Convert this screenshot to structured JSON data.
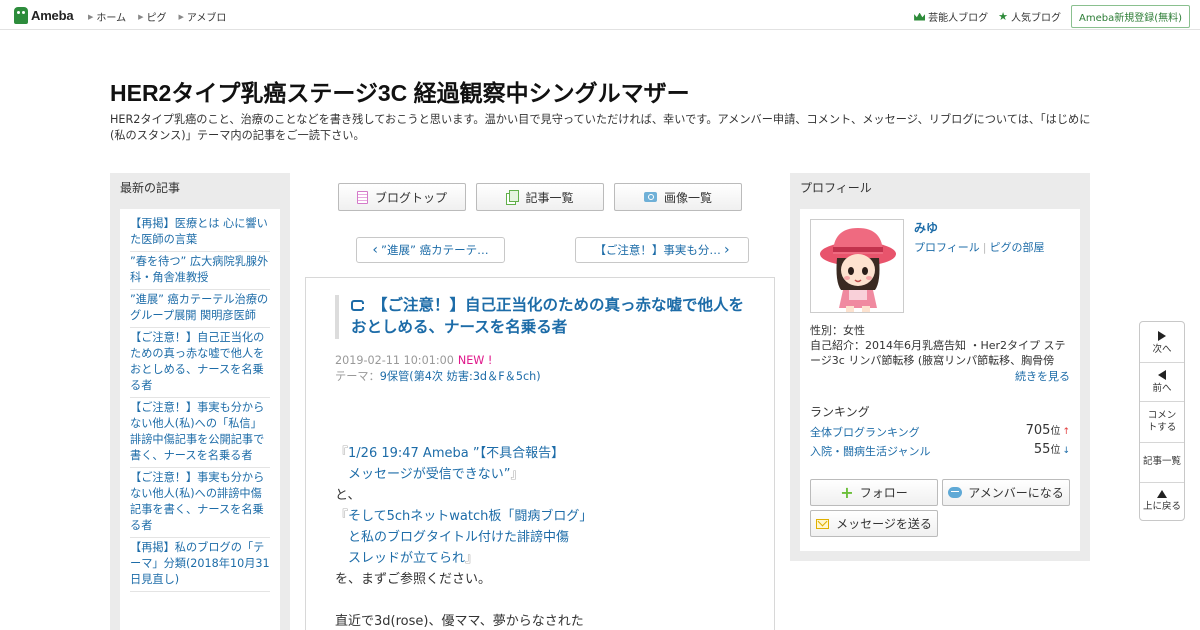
{
  "topbar": {
    "logo_text": "Ameba",
    "nav": [
      "ホーム",
      "ピグ",
      "アメブロ"
    ],
    "celeb_blog": "芸能人ブログ",
    "popular_blog": "人気ブログ",
    "register": "Ameba新規登録(無料)"
  },
  "blog": {
    "title": "HER2タイプ乳癌ステージ3C 経過観察中シングルマザー",
    "description": "HER2タイプ乳癌のこと、治療のことなどを書き残しておこうと思います。温かい目で見守っていただければ、幸いです。アメンバー申請、コメント、メッセージ、リブログについては、「はじめに(私のスタンス)」テーマ内の記事をご一読下さい。"
  },
  "recent": {
    "heading": "最新の記事",
    "items": [
      "【再掲】医療とは 心に響いた医師の言葉",
      "”春を待つ” 広大病院乳腺外科・角舎准教授",
      "”進展” 癌カテーテル治療のグループ展開 関明彦医師",
      "【ご注意！】自己正当化のための真っ赤な嘘で他人をおとしめる、ナースを名乗る者",
      "【ご注意！】事実も分からない他人(私)への「私信」誹謗中傷記事を公開記事で書く、ナースを名乗る者",
      "【ご注意！】事実も分からない他人(私)への誹謗中傷記事を書く、ナースを名乗る者",
      "【再掲】私のブログの「テーマ」分類(2018年10月31日見直し)"
    ]
  },
  "tabs": {
    "blog_top": "ブログトップ",
    "articles": "記事一覧",
    "images": "画像一覧"
  },
  "pager": {
    "prev": "”進展” 癌カテーテ…",
    "next": "【ご注意！】事実も分…",
    "prev_arrow": "‹",
    "next_arrow": "›"
  },
  "article": {
    "title": "【ご注意！】自己正当化のための真っ赤な嘘で他人をおとしめる、ナースを名乗る者",
    "date": "2019-02-11 10:01:00",
    "new_badge": "NEW !",
    "theme_label": "テーマ：",
    "theme": "9保管(第4次 妨害:3d＆F＆5ch)",
    "body": {
      "q1_open": "『",
      "link1_a": "1/26 19:47 Ameba ”【不具合報告】",
      "link1_b": "メッセージが受信できない”",
      "q1_close": "』",
      "to": "と、",
      "q2_open": "『",
      "link2_a": "そして5chネットwatch板「闘病ブログ」",
      "link2_b": "と私のブログタイトル付けた誹謗中傷",
      "link2_c": "スレッドが立てられ",
      "q2_close": "』",
      "please": "を、まずご参照ください。",
      "last": "直近で3d(rose)、優ママ、夢からなされた"
    }
  },
  "profile": {
    "heading": "プロフィール",
    "name": "みゆ",
    "profile_link": "プロフィール",
    "sep": "|",
    "pigg_link": "ピグの部屋",
    "gender": "性別：女性",
    "intro": "自己紹介：2014年6月乳癌告知 ・Her2タイプ ステージ3c リンパ節転移 (腋窩リンパ節転移、胸骨傍リ...",
    "more": "続きを見る",
    "ranking_label": "ランキング",
    "rankings": [
      {
        "name": "全体ブログランキング",
        "value": "705",
        "unit": "位",
        "trend": "↑"
      },
      {
        "name": "入院・闘病生活ジャンル",
        "value": "55",
        "unit": "位",
        "trend": "↓"
      }
    ],
    "follow": "フォロー",
    "amember": "アメンバーになる",
    "message": "メッセージを送る"
  },
  "sidenav": {
    "next": "次へ",
    "prev": "前へ",
    "comment": "コメントする",
    "list": "記事一覧",
    "top": "上に戻る"
  }
}
